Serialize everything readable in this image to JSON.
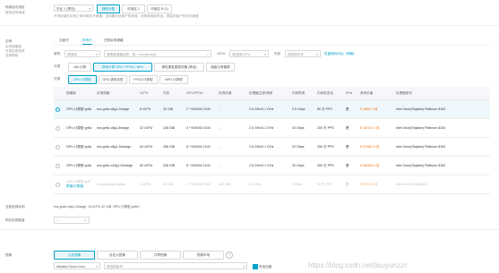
{
  "region": {
    "label": "地域及可用区",
    "sublabel": "新购选择地域",
    "region_value": "华北 1 (青岛)",
    "zones": [
      "随机分配",
      "可用区 1",
      "可用区 B (2)"
    ],
    "note": "不同地域的实例之间内网互不相通；选择靠近您客户的地域，可降低网络时延、提高您客户的访问速度"
  },
  "instance": {
    "label": "实例",
    "side_links": [
      "实例规格族",
      "可用实例选择",
      "选择帮助"
    ],
    "tabs": [
      "当前代",
      "所有代",
      "已购实例规格"
    ],
    "active_tab": 1,
    "filter": {
      "arch_label": "架构",
      "arch_placeholder": "请选择",
      "search_placeholder": "请搜索规格名称，如：ecs.g5.large",
      "vcpu_label": "vCPU",
      "vcpu_placeholder": "请选择vCPU",
      "mem_label": "内存",
      "mem_placeholder": "请选择内存",
      "compare_link": "性能指标对比（规格）"
    },
    "category_label": "分类",
    "categories": [
      "x86 计算",
      "异构计算 GPU / FPGA / NPU",
      "弹性裸金属服务器 (神龙)",
      "超级计算集群"
    ],
    "subtype_label": "分类",
    "subtypes": [
      "GPU 计算型",
      "GPU 虚拟化型",
      "FPGA 计算型",
      "NPU 计算型"
    ]
  },
  "table": {
    "headers": [
      "规格族",
      "实例规格",
      "vCPU",
      "内存",
      "GPU/FPGA",
      "实例存储",
      "处理器主频/睿频",
      "内网带宽",
      "内网收发包",
      "IPv6",
      "参考价格",
      "处理器型号"
    ],
    "rows": [
      {
        "family": "GPU 计算型 gn6v",
        "spec": "ecs.gn6v-c8g1.2xlarge",
        "vcpu": "8 vCPU",
        "mem": "32 GiB",
        "gpu": "1 * NVIDIA V100",
        "storage": "-",
        "freq": "2.5 GHz/3.1 GHz",
        "bw": "2.5 Gbps",
        "pps": "80 万 PPS",
        "ipv6": "是",
        "price": "¥ 4685.2 /月",
        "cpu": "Intel Xeon(Skylake) Platinum 8163"
      },
      {
        "family": "GPU 计算型 gn6v",
        "spec": "ecs.gn6v-c8g1.8xlarge",
        "vcpu": "32 vCPU",
        "mem": "128 GiB",
        "gpu": "4 * NVIDIA V100",
        "storage": "-",
        "freq": "2.5 GHz/3.1 GHz",
        "bw": "10 Gbps",
        "pps": "200 万 PPS",
        "ipv6": "是",
        "price": "¥ 18741.1 /月",
        "cpu": "Intel Xeon(Skylake) Platinum 8163"
      },
      {
        "family": "GPU 计算型 gn6v",
        "spec": "ecs.gn6v-c8g1.16xlarge",
        "vcpu": "64 vCPU",
        "mem": "256 GiB",
        "gpu": "8 * NVIDIA V100",
        "storage": "-",
        "freq": "2.5 GHz/3.1 GHz",
        "bw": "20 Gbps",
        "pps": "250 万 PPS",
        "ipv6": "是",
        "price": "¥ 37482.3 /月",
        "cpu": "Intel Xeon(Skylake) Platinum 8163"
      },
      {
        "family": "GPU 计算型 gn6v",
        "spec": "ecs.gn6v-c10g1.20xlarge",
        "vcpu": "82 vCPU",
        "mem": "336 GiB",
        "gpu": "8 * NVIDIA V100",
        "storage": "-",
        "freq": "2.5 GHz/3.1 GHz",
        "bw": "32 Gbps",
        "pps": "450 万 PPS",
        "ipv6": "是",
        "price": "¥ 38263.5 /月",
        "cpu": "Intel Xeon(Skylake) Platinum 8163"
      },
      {
        "family": "GPU 计算型 gn5",
        "spec": "ecs.gn5-c4g1.xlarge",
        "vcpu": "4 vCPU",
        "mem": "30 GiB",
        "gpu": "1 * NVIDIA P100",
        "storage": "440 GiB",
        "freq": "2.5 GHz",
        "bw": "3 Gbps",
        "pps": "30 万 PPS",
        "ipv6": "是",
        "price": "¥ 3094.6 /月",
        "cpu": "Intel Xeon E5-2682v4",
        "tag": "售罄/已售罄"
      }
    ]
  },
  "selected": {
    "label": "当前选择实例",
    "value": "ecs.gn6v-c8g1.2xlarge（8 vCPU 32 GiB, GPU 计算型 gn6v）"
  },
  "quantity": {
    "label": "购买实例数量"
  },
  "image": {
    "label": "镜像",
    "tabs": [
      "公共镜像",
      "自定义镜像",
      "共享镜像",
      "镜像市场"
    ],
    "os_value": "Alibaba Cloud Linux",
    "version_placeholder": "请选择版本",
    "security_label": "安全加固"
  },
  "watermark": "https://blog.csdn.net/jisuyunzzc",
  "colors": {
    "accent": "#00a2ca",
    "price": "#f56c00"
  }
}
